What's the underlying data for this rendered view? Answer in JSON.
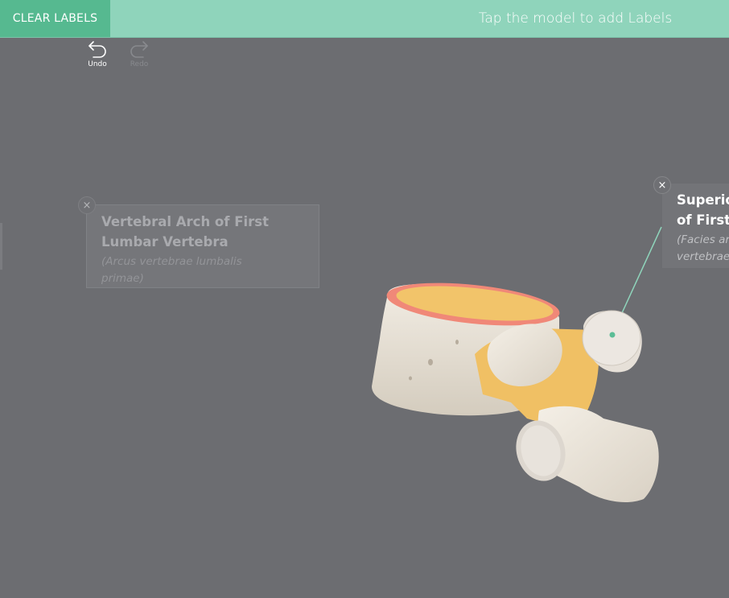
{
  "toolbar": {
    "clear_labels": "CLEAR LABELS",
    "hint": "Tap the model to add Labels",
    "undo_label": "Undo",
    "redo_label": "Redo"
  },
  "labels": [
    {
      "title_line1": "Vertebral Arch of First",
      "title_line2": "Lumbar Vertebra",
      "latin_line1": "(Arcus vertebrae lumbalis",
      "latin_line2": "primae)",
      "state": "dimmed"
    },
    {
      "title_line1": "Superio",
      "title_line2": "of First",
      "latin_line1": "(Facies ar",
      "latin_line2": "vertebrae",
      "state": "active"
    }
  ],
  "icons": {
    "close": "×",
    "undo": "undo-arrow-icon",
    "redo": "redo-arrow-icon"
  },
  "colors": {
    "accent": "#56b990",
    "topbar": "#8fd4bb",
    "background": "#6c6d71",
    "leader_line": "#8fd4bb",
    "bone": "#ece6db",
    "cartilage": "#f0c064",
    "disc_rim": "#f08878"
  }
}
